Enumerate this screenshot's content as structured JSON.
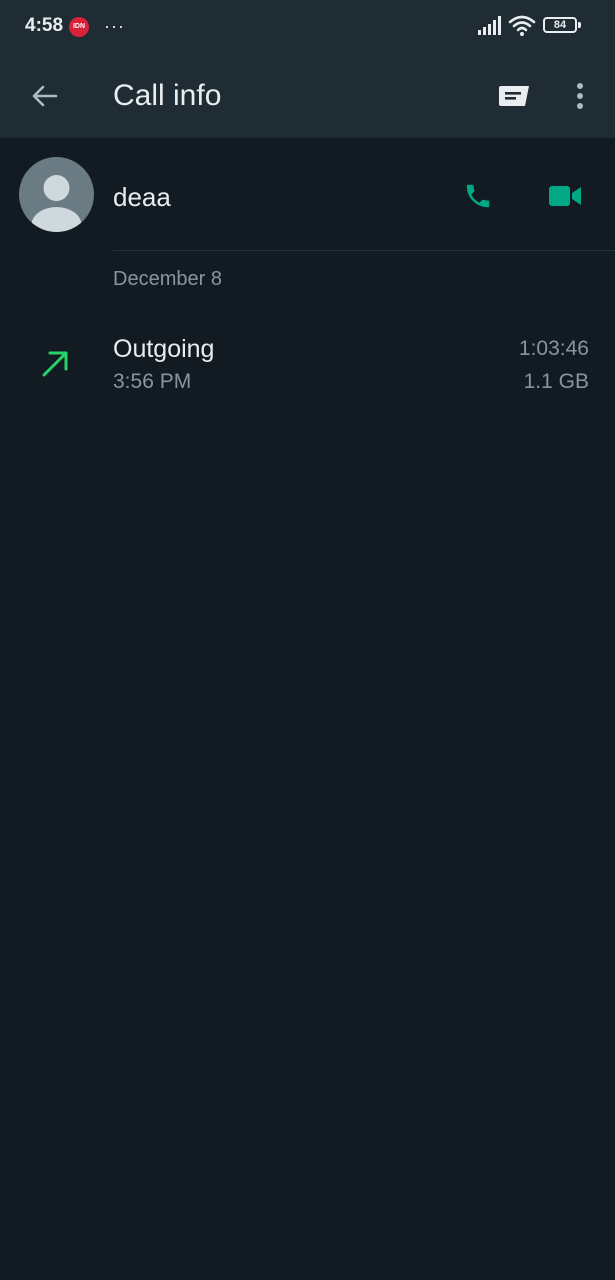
{
  "status_bar": {
    "time": "4:58",
    "badge": "IDN",
    "battery": "84"
  },
  "app_bar": {
    "title": "Call info"
  },
  "contact": {
    "name": "deaa"
  },
  "call_log": {
    "date": "December 8",
    "entries": [
      {
        "direction": "Outgoing",
        "time": "3:56 PM",
        "duration": "1:03:46",
        "data_used": "1.1 GB"
      }
    ]
  },
  "colors": {
    "accent": "#00a884",
    "outgoing_arrow": "#25d366",
    "background": "#121b22",
    "header": "#1f2c34"
  }
}
